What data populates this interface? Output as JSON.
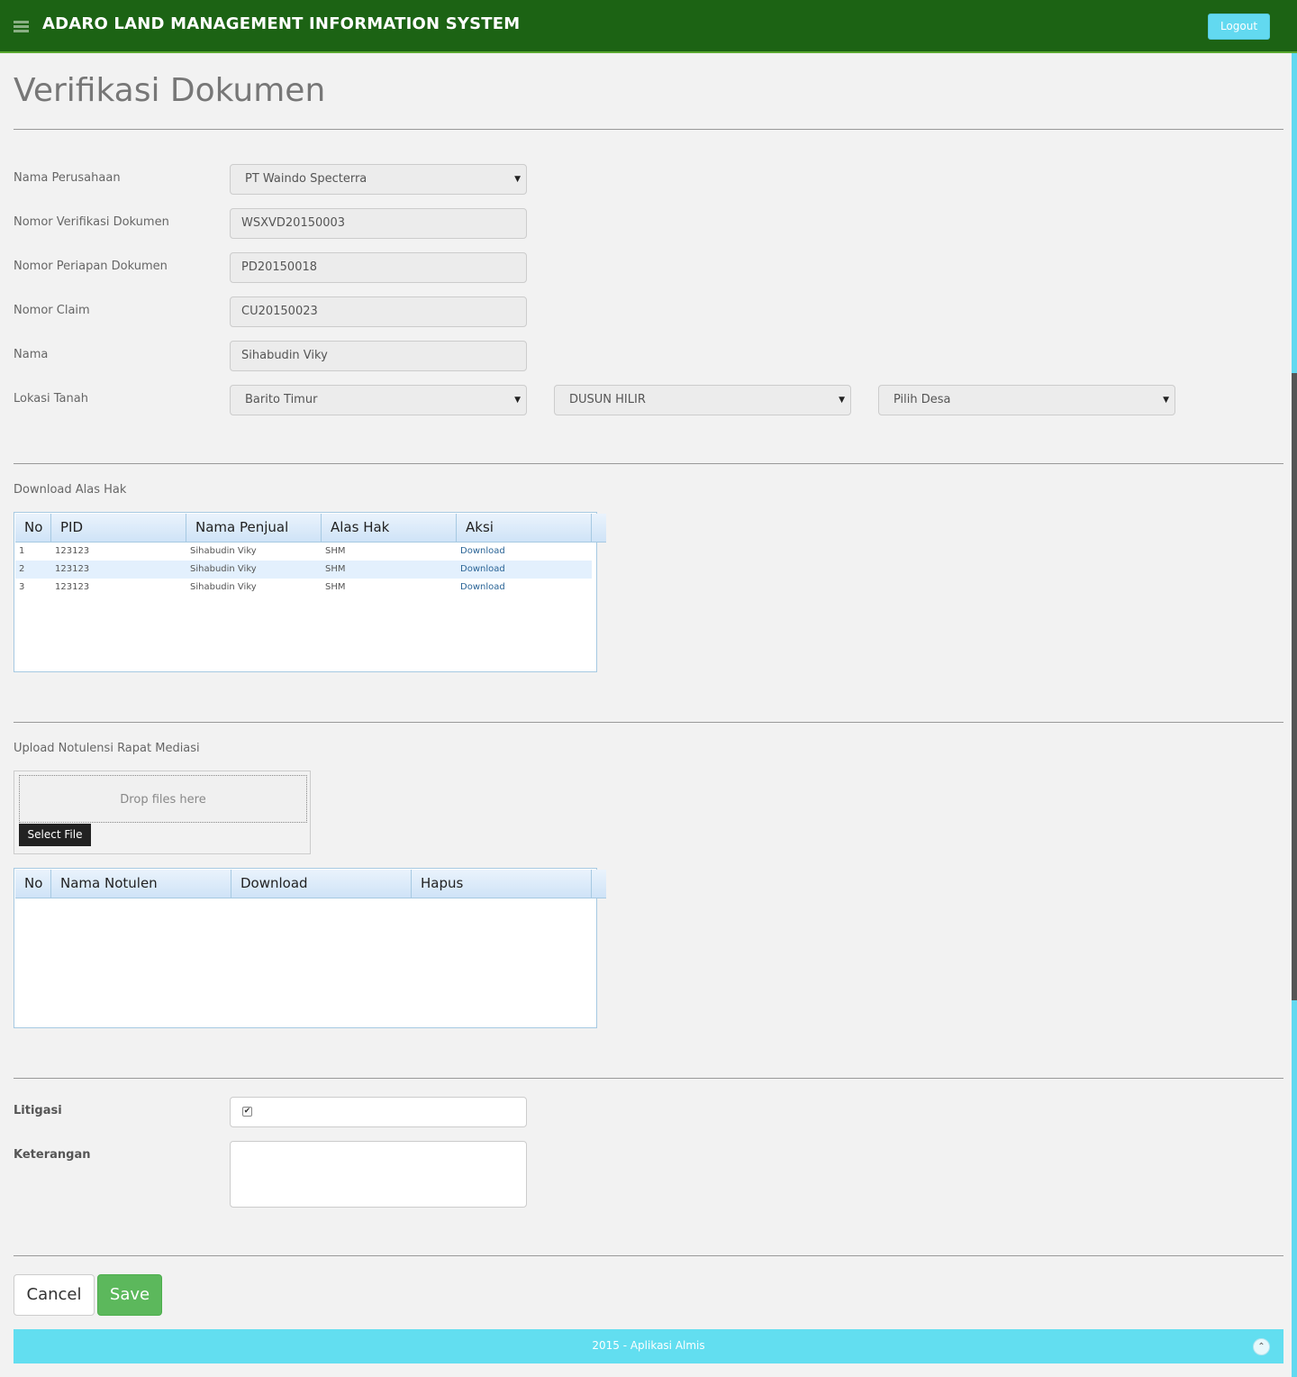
{
  "header": {
    "title": "ADARO LAND MANAGEMENT INFORMATION SYSTEM",
    "logout_label": "Logout",
    "brand_color": "#1c6314",
    "accent_color": "#62d9f0"
  },
  "page": {
    "title": "Verifikasi Dokumen"
  },
  "form": {
    "nama_perusahaan": {
      "label": "Nama Perusahaan",
      "value": "PT Waindo Specterra"
    },
    "nomor_verifikasi": {
      "label": "Nomor Verifikasi Dokumen",
      "value": "WSXVD20150003"
    },
    "nomor_periapan": {
      "label": "Nomor Periapan Dokumen",
      "value": "PD20150018"
    },
    "nomor_claim": {
      "label": "Nomor Claim",
      "value": "CU20150023"
    },
    "nama": {
      "label": "Nama",
      "value": "Sihabudin Viky"
    },
    "lokasi_tanah": {
      "label": "Lokasi Tanah",
      "kabupaten": "Barito Timur",
      "kecamatan": "DUSUN HILIR",
      "desa": "Pilih Desa"
    }
  },
  "alas_hak": {
    "section_label": "Download Alas Hak",
    "columns": [
      "No",
      "PID",
      "Nama Penjual",
      "Alas Hak",
      "Aksi"
    ],
    "rows": [
      {
        "no": "1",
        "pid": "123123",
        "nama": "Sihabudin Viky",
        "alas": "SHM",
        "aksi": "Download"
      },
      {
        "no": "2",
        "pid": "123123",
        "nama": "Sihabudin Viky",
        "alas": "SHM",
        "aksi": "Download"
      },
      {
        "no": "3",
        "pid": "123123",
        "nama": "Sihabudin Viky",
        "alas": "SHM",
        "aksi": "Download"
      }
    ]
  },
  "notulensi": {
    "section_label": "Upload Notulensi Rapat Mediasi",
    "dropzone_text": "Drop files here",
    "select_file_label": "Select File",
    "columns": [
      "No",
      "Nama Notulen",
      "Download",
      "Hapus"
    ]
  },
  "litigasi": {
    "label": "Litigasi",
    "checked": true
  },
  "keterangan": {
    "label": "Keterangan",
    "value": ""
  },
  "actions": {
    "cancel_label": "Cancel",
    "save_label": "Save"
  },
  "footer": {
    "text": "2015 - Aplikasi Almis"
  }
}
